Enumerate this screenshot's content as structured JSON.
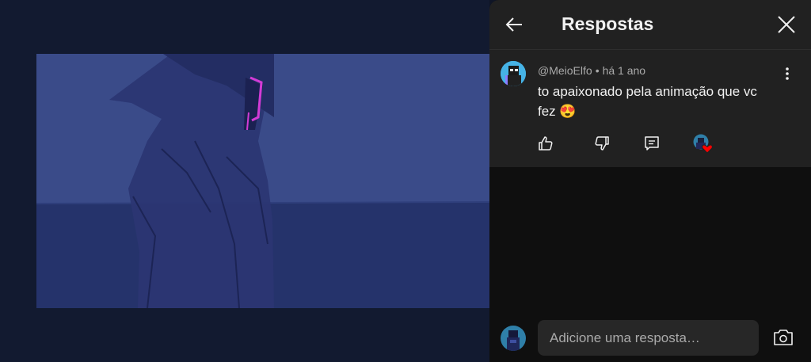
{
  "panel": {
    "title": "Respostas",
    "back_icon": "arrow-left-icon",
    "close_icon": "close-icon"
  },
  "comment": {
    "author": "@MeioElfo",
    "separator": "•",
    "time": "há 1 ano",
    "text": "to apaixonado pela animação que vc fez 😍",
    "icons": [
      "like-icon",
      "dislike-icon",
      "reply-icon",
      "creator-heart-icon",
      "more-vert-icon"
    ]
  },
  "footer": {
    "reply_placeholder": "Adicione uma resposta…",
    "camera_icon": "camera-icon"
  },
  "colors": {
    "panel_bg": "#0f0f0f",
    "header_bg": "#212121",
    "text_primary": "#f1f1f1",
    "text_secondary": "#aaaaaa",
    "heart": "#ff0000",
    "video_sky": "#3b4c8a"
  }
}
